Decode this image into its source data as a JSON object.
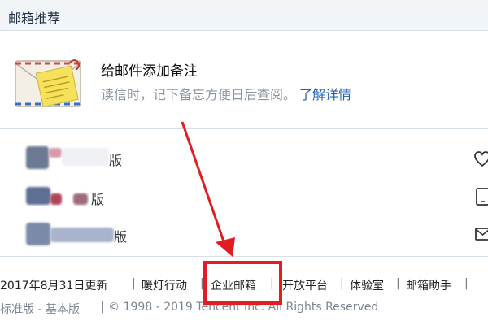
{
  "header": {
    "title": "邮箱推荐"
  },
  "feature": {
    "icon": "note-envelope-icon",
    "title": "给邮件添加备注",
    "description": "读信时，记下备忘方便日后查阅。",
    "link_label": "了解详情"
  },
  "versions": {
    "rows": [
      {
        "suffix": "版"
      },
      {
        "suffix": "版"
      },
      {
        "suffix": "版"
      }
    ],
    "side_icons": [
      "heart-icon",
      "tablet-icon",
      "mail-icon"
    ]
  },
  "footer": {
    "links": [
      "2017年8月31日更新",
      "暖灯行动",
      "企业邮箱",
      "开放平台",
      "体验室",
      "邮箱助手"
    ],
    "separator": "|",
    "copyright_left": "标准版 - 基本版",
    "copyright_right": "| © 1998 - 2019 Tencent Inc. All Rights Reserved"
  },
  "annotation": {
    "highlight_color": "#e11d24",
    "highlighted_item": "企业邮箱"
  },
  "colors": {
    "header_bg": "#f2f5f8",
    "link_blue": "#1d5fb8",
    "muted_text": "#8a96a3",
    "annotation_red": "#e11d24"
  }
}
